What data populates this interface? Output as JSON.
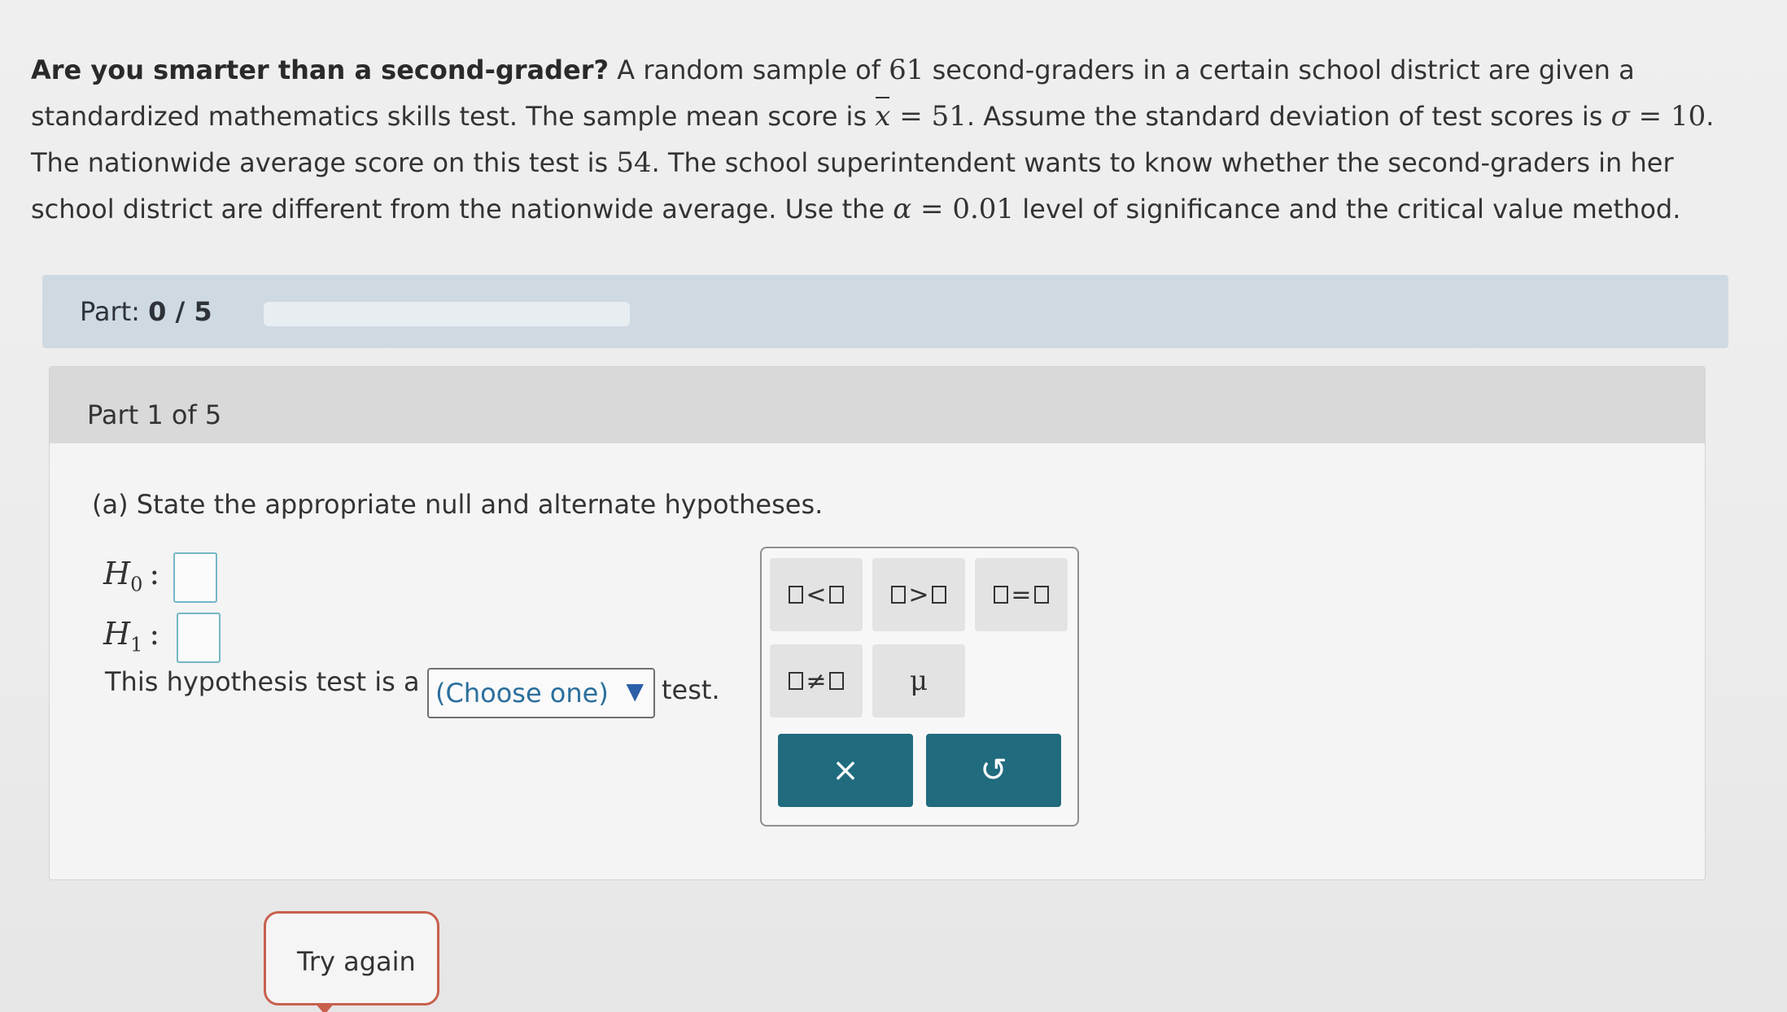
{
  "problem": {
    "lead": "Are you smarter than a second-grader?",
    "s1": " A random sample of ",
    "n": "61",
    "s2": " second-graders in a certain school district are given a standardized mathematics skills test. The sample mean score is ",
    "xvar": "x",
    "s3": " = ",
    "xbar_value": "51",
    "s4": ". Assume the standard deviation of test scores is ",
    "sigma": "σ",
    "s5": " = ",
    "sigma_value": "10",
    "s6": ". The nationwide average score on this test is ",
    "mu0": "54",
    "s7": ". The school superintendent wants to know whether the second-graders in her school district are different from the nationwide average. Use the ",
    "alpha": "α",
    "s8": " = ",
    "alpha_value": "0.01",
    "s9": " level of significance and the critical value method."
  },
  "part_bar": {
    "label": "Part: ",
    "progress": "0 / 5",
    "progress_fraction": 0
  },
  "part": {
    "header": "Part 1 of 5",
    "question": "(a) State the appropriate null and alternate hypotheses.",
    "h0_letter": "H",
    "h0_sub": "0",
    "h1_letter": "H",
    "h1_sub": "1",
    "colon": ":",
    "test_prefix": "This hypothesis test is a",
    "dropdown_value": "(Choose one)",
    "dropdown_arrow": "▼",
    "test_suffix": "test."
  },
  "keypad": {
    "less_than": "<",
    "greater_than": ">",
    "equals": "=",
    "not_equal": "≠",
    "mu": "μ",
    "clear_icon": "×",
    "undo_icon": "↺"
  },
  "feedback": {
    "try_again": "Try again"
  },
  "colors": {
    "accent": "#206b7e",
    "part_bar": "#cfd9e2",
    "try_again_border": "#c9604e",
    "answer_box_border": "#74b7c5"
  }
}
